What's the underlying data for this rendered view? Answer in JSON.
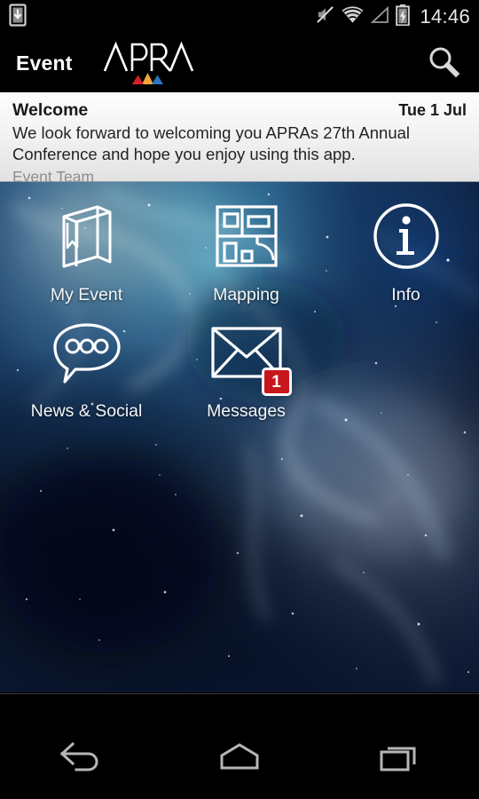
{
  "status_bar": {
    "download_icon": "download-icon",
    "mute_icon": "volume-mute-icon",
    "wifi_icon": "wifi-icon",
    "signal_icon": "cell-signal-icon",
    "battery_icon": "battery-charging-icon",
    "clock": "14:46"
  },
  "action_bar": {
    "title": "Event",
    "brand": "APRA",
    "brand_colors": {
      "red": "#d62027",
      "orange": "#f0a63c",
      "blue": "#2a77bd"
    },
    "search_icon": "search-icon"
  },
  "welcome": {
    "title": "Welcome",
    "date": "Tue 1 Jul",
    "body": "We look forward to welcoming you APRAs 27th Annual Conference and hope you enjoy using this app.",
    "author": "Event Team"
  },
  "grid": {
    "items": [
      {
        "label": "My Event",
        "icon": "book-icon",
        "badge": null
      },
      {
        "label": "Mapping",
        "icon": "floorplan-icon",
        "badge": null
      },
      {
        "label": "Info",
        "icon": "info-circle-icon",
        "badge": null
      },
      {
        "label": "News & Social",
        "icon": "speech-bubble-icon",
        "badge": null
      },
      {
        "label": "Messages",
        "icon": "envelope-icon",
        "badge": "1"
      }
    ]
  },
  "nav_bar": {
    "back_icon": "back-arrow-icon",
    "home_icon": "home-icon",
    "recents_icon": "recent-apps-icon"
  },
  "theme": {
    "badge_red": "#c8161d",
    "banner_bg": "#f3f3f3",
    "nebula_blue": "#0d1f3d"
  }
}
